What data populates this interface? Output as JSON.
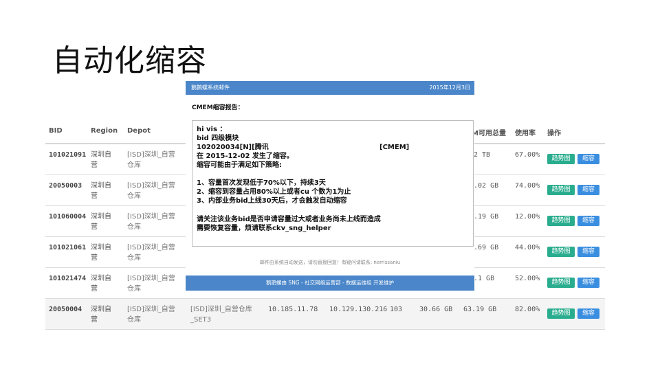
{
  "slide": {
    "title": "自动化缩容"
  },
  "table": {
    "headers": {
      "bid": "BID",
      "region": "Region",
      "depot": "Depot",
      "capacity": "M可用总量",
      "usage": "使用率",
      "action": "操作"
    },
    "rows": [
      {
        "bid": "101021091",
        "region_l1": "深圳自",
        "region_l2": "营",
        "depot_l1": "[ISD]深圳_自营",
        "depot_l2": "仓库",
        "capacity": "2 TB",
        "usage": "67.00%",
        "btn_trend": "趋势图",
        "btn_shrink": "缩容"
      },
      {
        "bid": "20050003",
        "region_l1": "深圳自",
        "region_l2": "营",
        "depot_l1": "[ISD]深圳_自营",
        "depot_l2": "仓库",
        "capacity": ".02 GB",
        "usage": "74.00%",
        "btn_trend": "趋势图",
        "btn_shrink": "缩容"
      },
      {
        "bid": "101060004",
        "region_l1": "深圳自",
        "region_l2": "营",
        "depot_l1": "[ISD]深圳_自营",
        "depot_l2": "仓库",
        "capacity": ".19 GB",
        "usage": "12.00%",
        "btn_trend": "趋势图",
        "btn_shrink": "缩容"
      },
      {
        "bid": "101021061",
        "region_l1": "深圳自",
        "region_l2": "营",
        "depot_l1": "[ISD]深圳_自营",
        "depot_l2": "仓库",
        "capacity": ".69 GB",
        "usage": "44.00%",
        "btn_trend": "趋势图",
        "btn_shrink": "缩容"
      },
      {
        "bid": "101021474",
        "region_l1": "深圳自",
        "region_l2": "营",
        "depot_l1": "[ISD]深圳_自营",
        "depot_l2": "仓库",
        "capacity": ".1 GB",
        "usage": "52.00%",
        "btn_trend": "趋势图",
        "btn_shrink": "缩容"
      }
    ],
    "last_row": {
      "bid": "20050004",
      "region_l1": "深圳自",
      "region_l2": "营",
      "depot_l1": "[ISD]深圳_自营",
      "depot_l2": "仓库",
      "set_l1": "[ISD]深圳_自营仓库",
      "set_l2": "_SET3",
      "ip1": "10.185.11.78",
      "ip2": "10.129.130.216",
      "port": "103",
      "used": "30.66 GB",
      "capacity": "63.19 GB",
      "usage": "82.00%",
      "btn_trend": "趋势图",
      "btn_shrink": "缩容"
    }
  },
  "email": {
    "sender": "鹅鹊螺系统邮件",
    "date": "2015年12月3日",
    "subject": "CMEM缩容报告：",
    "body": {
      "greeting": "hi vis ：",
      "module": "bid 四级模块",
      "bid_line": "102020034[N][腾讯",
      "cmem_tag": "[CMEM]",
      "date_line": "在 2015-12-02 发生了缩容。",
      "policy_intro": "缩容可能由于满足如下策略:",
      "policy_1": "1、容量首次发现低于70%以下，持续3天",
      "policy_2": "2、缩容到容量占用80%以上或者cu 个数为1为止",
      "policy_3": "3、内部业务bid上线30天后，才会触发自动缩容",
      "notice_1": "请关注该业务bid是否申请容量过大或者业务尚未上线而造成",
      "notice_2": "需要恢复容量，烦请联系ckv_sng_helper"
    },
    "footnote": "邮件由系统自动发送，请勿直接回复！有疑问请联系: nerrissaniu",
    "footer": "鹅鹊螺由 SNG - 社交网络运营部 - 数据运维组 开发维护"
  }
}
